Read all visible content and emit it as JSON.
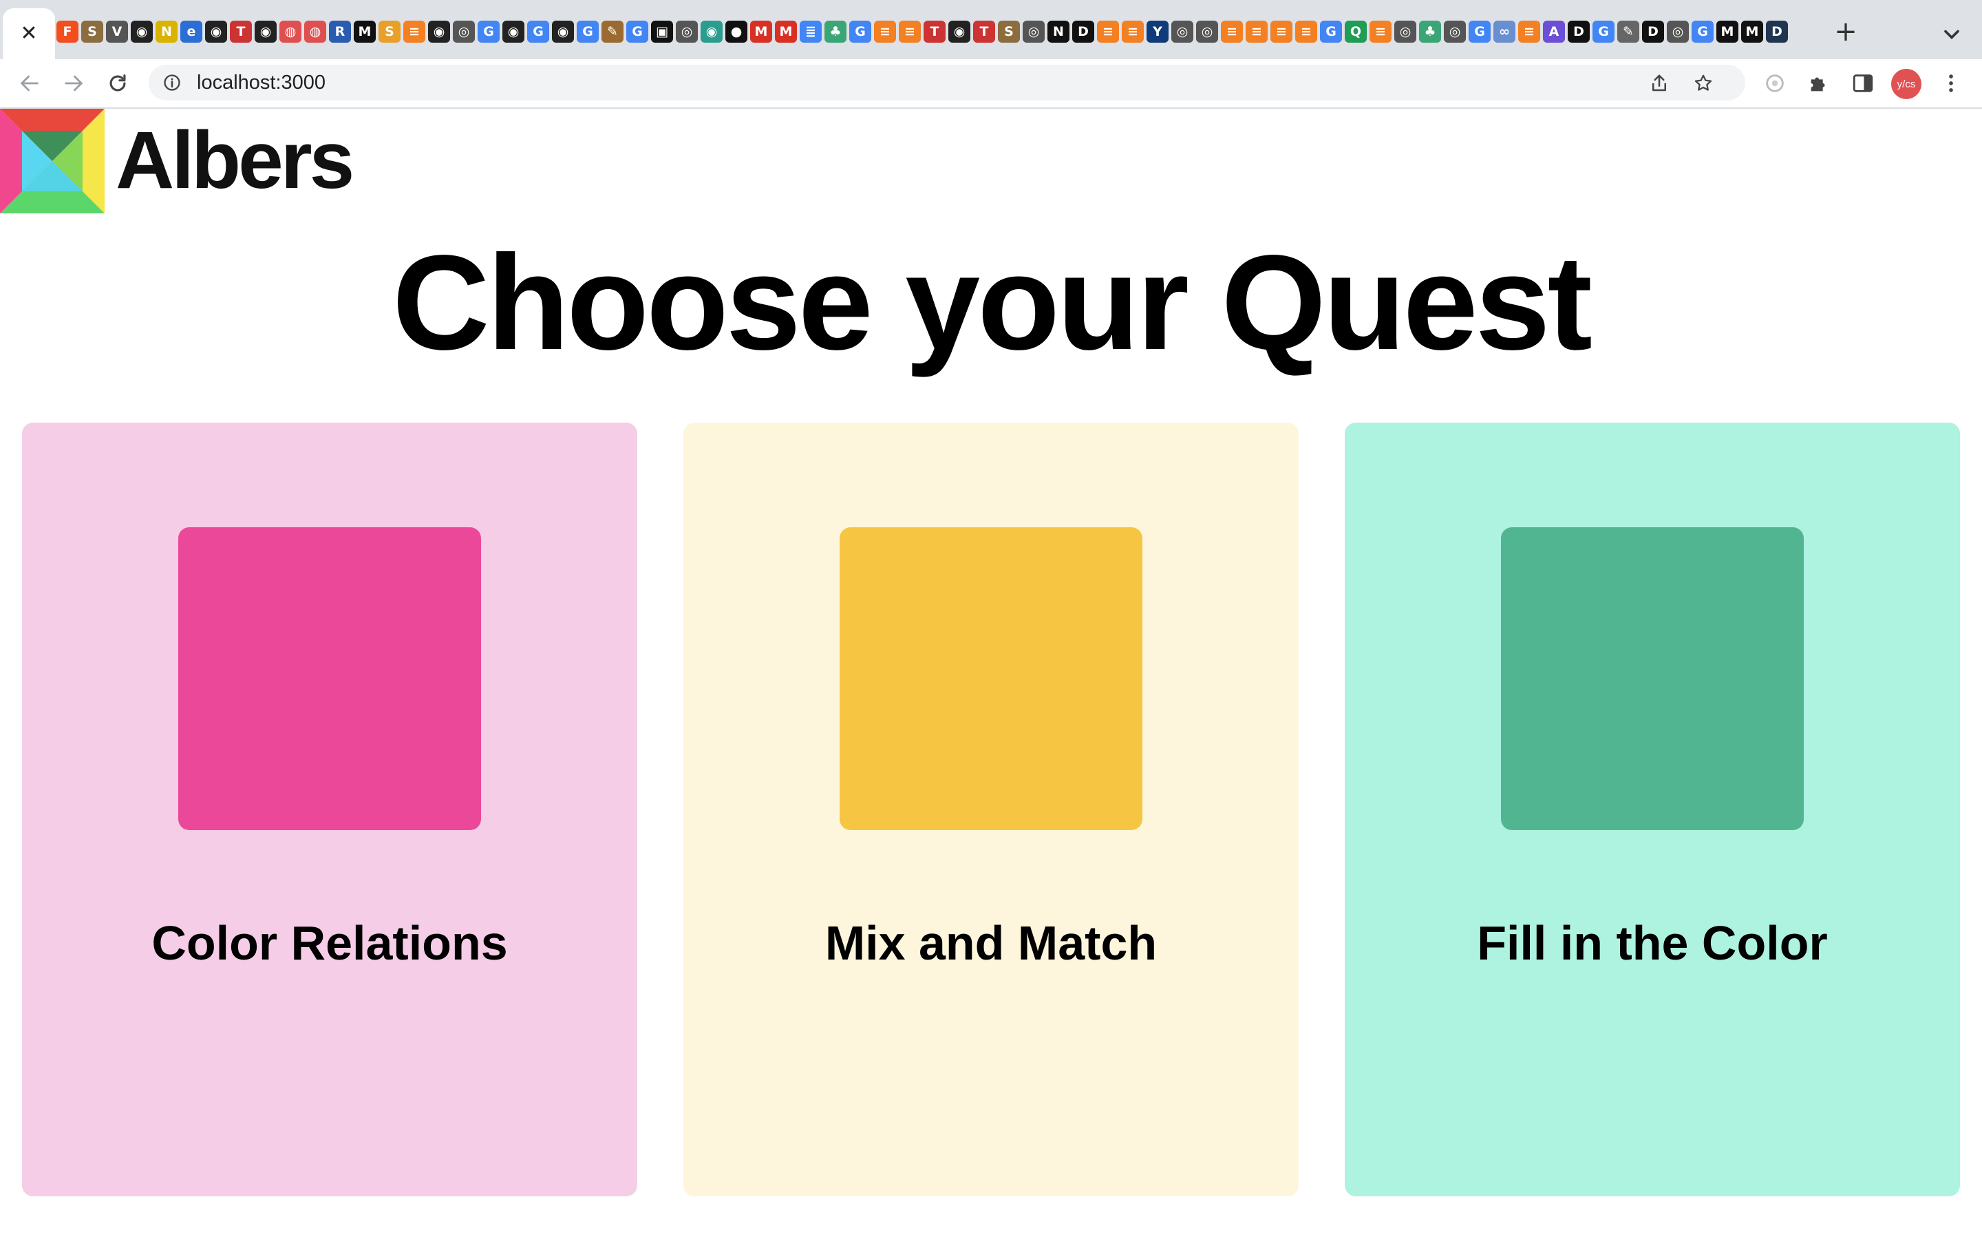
{
  "browser": {
    "active_tab_close": "✕",
    "new_tab": "+",
    "tab_favicons": [
      {
        "name": "figma-favicon",
        "glyph": "F",
        "color": "#f24e1e"
      },
      {
        "name": "scholar-favicon",
        "glyph": "S",
        "color": "#8b6d3f"
      },
      {
        "name": "vercel-favicon",
        "glyph": "V",
        "color": "#555"
      },
      {
        "name": "github-favicon",
        "glyph": "◉",
        "color": "#222"
      },
      {
        "name": "notion-favicon",
        "glyph": "N",
        "color": "#d9b300"
      },
      {
        "name": "edge-favicon",
        "glyph": "e",
        "color": "#2b6fd6"
      },
      {
        "name": "github-favicon",
        "glyph": "◉",
        "color": "#222"
      },
      {
        "name": "todo-favicon",
        "glyph": "T",
        "color": "#cc3333"
      },
      {
        "name": "github-favicon",
        "glyph": "◉",
        "color": "#222"
      },
      {
        "name": "palette-favicon",
        "glyph": "◍",
        "color": "#e04f4f"
      },
      {
        "name": "palette-favicon",
        "glyph": "◍",
        "color": "#e04f4f"
      },
      {
        "name": "r-favicon",
        "glyph": "R",
        "color": "#2a5db0"
      },
      {
        "name": "medium-favicon",
        "glyph": "M",
        "color": "#111"
      },
      {
        "name": "sheets-favicon",
        "glyph": "S",
        "color": "#e8a02a"
      },
      {
        "name": "stackoverflow-favicon",
        "glyph": "≡",
        "color": "#f48024"
      },
      {
        "name": "github-favicon",
        "glyph": "◉",
        "color": "#222"
      },
      {
        "name": "chrome-favicon",
        "glyph": "◎",
        "color": "#555"
      },
      {
        "name": "google-favicon",
        "glyph": "G",
        "color": "#4285f4"
      },
      {
        "name": "github-favicon",
        "glyph": "◉",
        "color": "#222"
      },
      {
        "name": "google-favicon",
        "glyph": "G",
        "color": "#4285f4"
      },
      {
        "name": "github-favicon",
        "glyph": "◉",
        "color": "#222"
      },
      {
        "name": "google-favicon",
        "glyph": "G",
        "color": "#4285f4"
      },
      {
        "name": "paint-favicon",
        "glyph": "✎",
        "color": "#9a6a30"
      },
      {
        "name": "google-favicon",
        "glyph": "G",
        "color": "#4285f4"
      },
      {
        "name": "codepen-favicon",
        "glyph": "▣",
        "color": "#111"
      },
      {
        "name": "chrome-favicon",
        "glyph": "◎",
        "color": "#555"
      },
      {
        "name": "eye-favicon",
        "glyph": "◉",
        "color": "#2a9d8f"
      },
      {
        "name": "dark-favicon",
        "glyph": "●",
        "color": "#111"
      },
      {
        "name": "gmail-favicon",
        "glyph": "M",
        "color": "#d93025"
      },
      {
        "name": "gmail-favicon",
        "glyph": "M",
        "color": "#d93025"
      },
      {
        "name": "docs-favicon",
        "glyph": "≣",
        "color": "#4285f4"
      },
      {
        "name": "tree-favicon",
        "glyph": "♣",
        "color": "#3aa676"
      },
      {
        "name": "google-favicon",
        "glyph": "G",
        "color": "#4285f4"
      },
      {
        "name": "stackoverflow-favicon",
        "glyph": "≡",
        "color": "#f48024"
      },
      {
        "name": "stackoverflow-favicon",
        "glyph": "≡",
        "color": "#f48024"
      },
      {
        "name": "todo-favicon",
        "glyph": "T",
        "color": "#cc3333"
      },
      {
        "name": "github-favicon",
        "glyph": "◉",
        "color": "#222"
      },
      {
        "name": "todo-favicon",
        "glyph": "T",
        "color": "#cc3333"
      },
      {
        "name": "scholar-favicon",
        "glyph": "S",
        "color": "#8b6d3f"
      },
      {
        "name": "chrome-favicon",
        "glyph": "◎",
        "color": "#555"
      },
      {
        "name": "notion-favicon",
        "glyph": "N",
        "color": "#111"
      },
      {
        "name": "dev-favicon",
        "glyph": "D",
        "color": "#111"
      },
      {
        "name": "stackoverflow-favicon",
        "glyph": "≡",
        "color": "#f48024"
      },
      {
        "name": "stackoverflow-favicon",
        "glyph": "≡",
        "color": "#f48024"
      },
      {
        "name": "yale-favicon",
        "glyph": "Y",
        "color": "#0f3b7a"
      },
      {
        "name": "chrome-favicon",
        "glyph": "◎",
        "color": "#555"
      },
      {
        "name": "chrome-favicon",
        "glyph": "◎",
        "color": "#555"
      },
      {
        "name": "stackoverflow-favicon",
        "glyph": "≡",
        "color": "#f48024"
      },
      {
        "name": "stackoverflow-favicon",
        "glyph": "≡",
        "color": "#f48024"
      },
      {
        "name": "stackoverflow-favicon",
        "glyph": "≡",
        "color": "#f48024"
      },
      {
        "name": "stackoverflow-favicon",
        "glyph": "≡",
        "color": "#f48024"
      },
      {
        "name": "google-favicon",
        "glyph": "G",
        "color": "#4285f4"
      },
      {
        "name": "search-favicon",
        "glyph": "Q",
        "color": "#1f9d55"
      },
      {
        "name": "stackoverflow-favicon",
        "glyph": "≡",
        "color": "#f48024"
      },
      {
        "name": "chrome-favicon",
        "glyph": "◎",
        "color": "#555"
      },
      {
        "name": "tree-favicon",
        "glyph": "♣",
        "color": "#3aa676"
      },
      {
        "name": "chrome-favicon",
        "glyph": "◎",
        "color": "#555"
      },
      {
        "name": "google-favicon",
        "glyph": "G",
        "color": "#4285f4"
      },
      {
        "name": "wave-favicon",
        "glyph": "∞",
        "color": "#6a8fd0"
      },
      {
        "name": "stackoverflow-favicon",
        "glyph": "≡",
        "color": "#f48024"
      },
      {
        "name": "astro-favicon",
        "glyph": "A",
        "color": "#6b4fd6"
      },
      {
        "name": "dev-favicon",
        "glyph": "D",
        "color": "#111"
      },
      {
        "name": "google-favicon",
        "glyph": "G",
        "color": "#4285f4"
      },
      {
        "name": "leaf-favicon",
        "glyph": "✎",
        "color": "#666"
      },
      {
        "name": "dev-favicon",
        "glyph": "D",
        "color": "#111"
      },
      {
        "name": "chrome-favicon",
        "glyph": "◎",
        "color": "#555"
      },
      {
        "name": "google-favicon",
        "glyph": "G",
        "color": "#4285f4"
      },
      {
        "name": "medium-favicon",
        "glyph": "M",
        "color": "#111"
      },
      {
        "name": "medium-favicon",
        "glyph": "M",
        "color": "#111"
      },
      {
        "name": "d-favicon",
        "glyph": "D",
        "color": "#1f3550"
      }
    ],
    "address_bar": {
      "url": "localhost:3000"
    },
    "profile_initials": "y/cs"
  },
  "page": {
    "brand_name": "Albers",
    "heading": "Choose your Quest",
    "quests": [
      {
        "title": "Color Relations",
        "card_color": "#f6cde6",
        "swatch_color": "#ec4899"
      },
      {
        "title": "Mix and Match",
        "card_color": "#fdf6dd",
        "swatch_color": "#f6c643"
      },
      {
        "title": "Fill in the Color",
        "card_color": "#aef2e0",
        "swatch_color": "#52b591"
      }
    ]
  }
}
